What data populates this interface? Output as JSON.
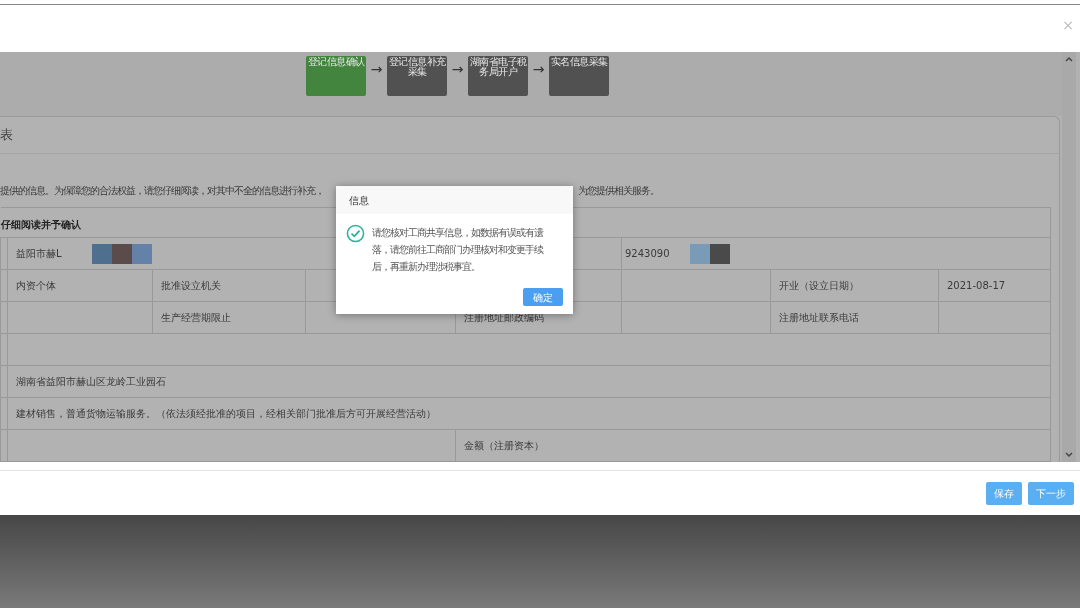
{
  "window": {
    "close": "×"
  },
  "steps": [
    {
      "label": "登记信息确认",
      "selected": true
    },
    {
      "label": "登记信息补充采集",
      "selected": false
    },
    {
      "label": "湖南省电子税务局开户",
      "selected": false
    },
    {
      "label": "实名信息采集",
      "selected": false
    }
  ],
  "step_arrow": "→",
  "panel": {
    "title": "表",
    "intro_left": "提供的信息。为保障您的合法权益，请您仔细阅读，对其中不全的信息进行补充，",
    "intro_right": "为您提供相关服务。",
    "section_heading": "仔细阅读并予确认"
  },
  "table": {
    "rows": [
      {
        "cells": [
          {
            "text": "益阳市赫L",
            "colspan": 4
          },
          {
            "text": "9243090",
            "colspan": 3
          }
        ],
        "kind": "redacted"
      },
      {
        "cells": [
          "内资个体",
          "批准设立机关",
          "",
          "",
          "",
          "开业（设立日期）",
          "2021-08-17"
        ],
        "kind": "grid"
      },
      {
        "cells": [
          "",
          "生产经营期限止",
          "",
          "注册地址邮政编码",
          "",
          "注册地址联系电话",
          ""
        ],
        "kind": "grid"
      },
      {
        "cells": [
          {
            "text": "",
            "colspan": 7
          }
        ],
        "kind": "wide"
      },
      {
        "cells": [
          {
            "text": "湖南省益阳市赫山区龙岭工业园石",
            "colspan": 7
          }
        ],
        "kind": "wide"
      },
      {
        "cells": [
          {
            "text": "建材销售，普通货物运输服务。（依法须经批准的项目，经相关部门批准后方可开展经营活动）",
            "colspan": 7
          }
        ],
        "kind": "wide"
      },
      {
        "cells": [
          {
            "text": "",
            "colspan": 3
          },
          {
            "text": "金额（注册资本）",
            "colspan": 4
          }
        ],
        "kind": "split"
      }
    ]
  },
  "dialog": {
    "title": "信息",
    "message": "请您核对工商共享信息，如数据有误或有遗落，请您前往工商部门办理核对和变更手续后，再重新办理涉税事宜。",
    "button": "确定"
  },
  "footer": {
    "buttons": [
      "保存",
      "下一步"
    ]
  }
}
